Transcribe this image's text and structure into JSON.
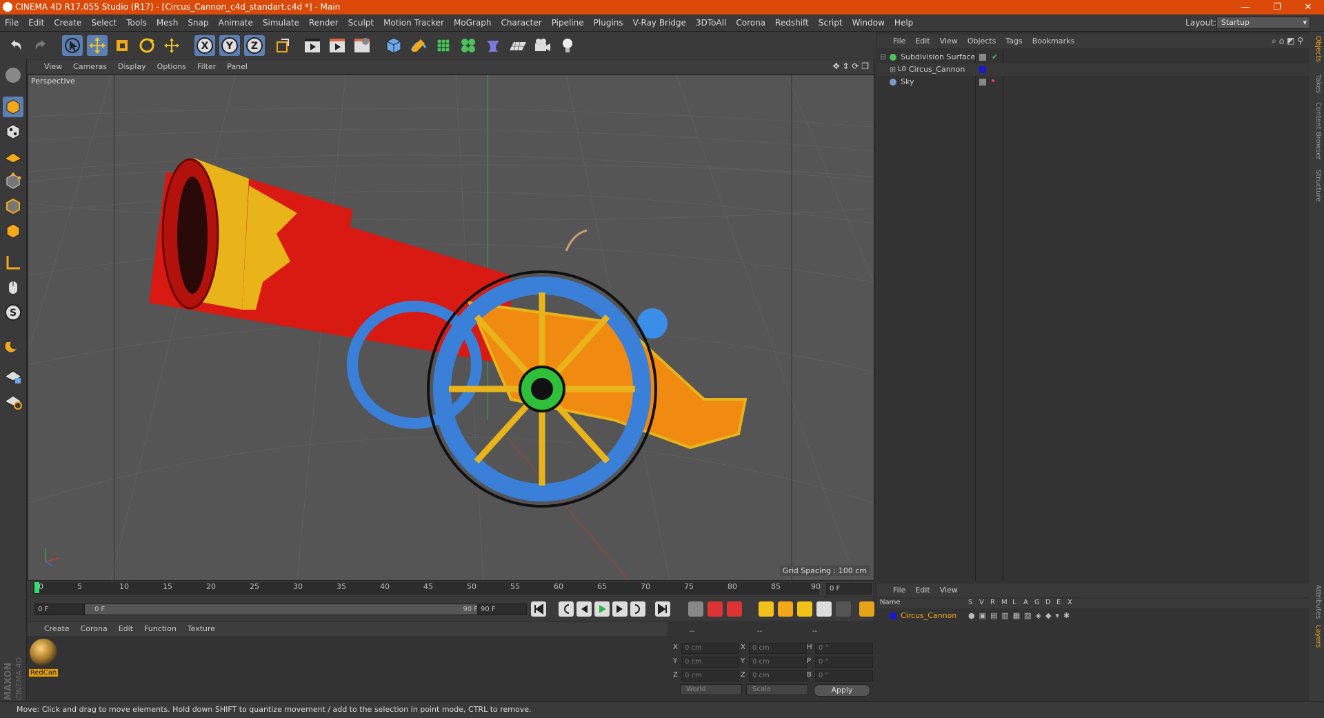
{
  "window": {
    "title": "CINEMA 4D R17.055 Studio (R17) - [Circus_Cannon_c4d_standart.c4d *] - Main",
    "minimize": "—",
    "restore": "❐",
    "close": "✕"
  },
  "menubar": {
    "items": [
      "File",
      "Edit",
      "Create",
      "Select",
      "Tools",
      "Mesh",
      "Snap",
      "Animate",
      "Simulate",
      "Render",
      "Sculpt",
      "Motion Tracker",
      "MoGraph",
      "Character",
      "Pipeline",
      "Plugins",
      "V-Ray Bridge",
      "3DToAll",
      "Corona",
      "Redshift",
      "Script",
      "Window",
      "Help"
    ],
    "layout_label": "Layout:",
    "layout_value": "Startup"
  },
  "toolbar": {
    "icons": [
      "undo-icon",
      "redo-icon",
      "live-select-icon",
      "move-icon",
      "scale-icon",
      "rotate-icon",
      "transform-icon",
      "x-axis-icon",
      "y-axis-icon",
      "z-axis-icon",
      "coordinate-system-icon",
      "render-view-icon",
      "render-picture-viewer-icon",
      "edit-render-settings-icon",
      "cube-primitive-icon",
      "pen-spline-icon",
      "subdivision-surface-icon",
      "cloner-icon",
      "deformer-icon",
      "floor-icon",
      "camera-icon",
      "light-icon"
    ]
  },
  "viewport": {
    "menu": [
      "View",
      "Cameras",
      "Display",
      "Options",
      "Filter",
      "Panel"
    ],
    "label": "Perspective",
    "grid_spacing": "Grid Spacing : 100 cm"
  },
  "timeline": {
    "ticks": [
      "0",
      "5",
      "10",
      "15",
      "20",
      "25",
      "30",
      "35",
      "40",
      "45",
      "50",
      "55",
      "60",
      "65",
      "70",
      "75",
      "80",
      "85",
      "90"
    ],
    "current_frame": "0 F"
  },
  "transport": {
    "start_field": "0 F",
    "range_start": "0 F",
    "range_end": "90 F",
    "end_field": "90 F"
  },
  "material_manager": {
    "menu": [
      "Create",
      "Corona",
      "Edit",
      "Function",
      "Texture"
    ],
    "material_name": "RedCan"
  },
  "coordinates": {
    "headers": [
      "--",
      "--",
      "--"
    ],
    "rows": [
      {
        "a": "X",
        "av": "0 cm",
        "b": "X",
        "bv": "0 cm",
        "c": "H",
        "cv": "0 °"
      },
      {
        "a": "Y",
        "av": "0 cm",
        "b": "Y",
        "bv": "0 cm",
        "c": "P",
        "cv": "0 °"
      },
      {
        "a": "Z",
        "av": "0 cm",
        "b": "Z",
        "bv": "0 cm",
        "c": "B",
        "cv": "0 °"
      }
    ],
    "world": "World",
    "scale": "Scale",
    "apply": "Apply"
  },
  "object_manager": {
    "menu": [
      "File",
      "Edit",
      "View",
      "Objects",
      "Tags",
      "Bookmarks"
    ],
    "objects": [
      {
        "name": "Subdivision Surface",
        "color": "#4cc25a"
      },
      {
        "name": "Circus_Cannon",
        "color": "#1a1acc"
      },
      {
        "name": "Sky",
        "color": "#7a9bc8"
      }
    ]
  },
  "layer_manager": {
    "menu": [
      "File",
      "Edit",
      "View"
    ],
    "columns": [
      "Name",
      "S",
      "V",
      "R",
      "M",
      "L",
      "A",
      "G",
      "D",
      "E",
      "X"
    ],
    "layer_name": "Circus_Cannon"
  },
  "side_tabs": [
    "Objects",
    "Takes",
    "Content Browser",
    "Structure",
    "Attributes",
    "Layers"
  ],
  "maxon_logo": [
    "MAXON",
    "CINEMA 4D"
  ],
  "status": "Move: Click and drag to move elements. Hold down SHIFT to quantize movement / add to the selection in point mode, CTRL to remove."
}
